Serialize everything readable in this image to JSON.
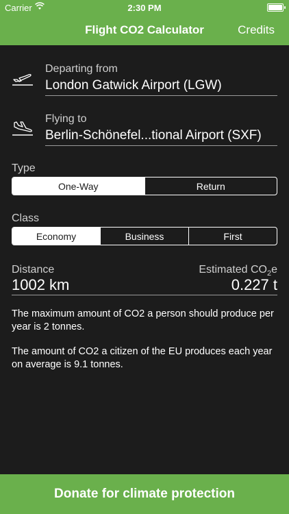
{
  "status_bar": {
    "carrier": "Carrier",
    "time": "2:30 PM",
    "battery_level": 1.0
  },
  "nav": {
    "title": "Flight CO2 Calculator",
    "credits_label": "Credits"
  },
  "departure": {
    "label": "Departing from",
    "value": "London Gatwick Airport (LGW)",
    "icon": "plane-takeoff-icon"
  },
  "arrival": {
    "label": "Flying to",
    "value": "Berlin-Schönefel...tional Airport (SXF)",
    "icon": "plane-landing-icon"
  },
  "type": {
    "label": "Type",
    "options": [
      "One-Way",
      "Return"
    ],
    "selected": "One-Way"
  },
  "class": {
    "label": "Class",
    "options": [
      "Economy",
      "Business",
      "First"
    ],
    "selected": "Economy"
  },
  "distance": {
    "label": "Distance",
    "value": "1002 km"
  },
  "emissions": {
    "label_prefix": "Estimated CO",
    "label_sub": "2",
    "label_suffix": "e",
    "value": "0.227 t"
  },
  "info": {
    "line1": "The maximum amount of CO2 a person should produce per year is 2 tonnes.",
    "line2": "The amount of CO2 a citizen of the EU produces each year on average is 9.1 tonnes."
  },
  "donate_label": "Donate for climate protection",
  "colors": {
    "accent": "#6ab04c",
    "background": "#1c1c1c"
  }
}
